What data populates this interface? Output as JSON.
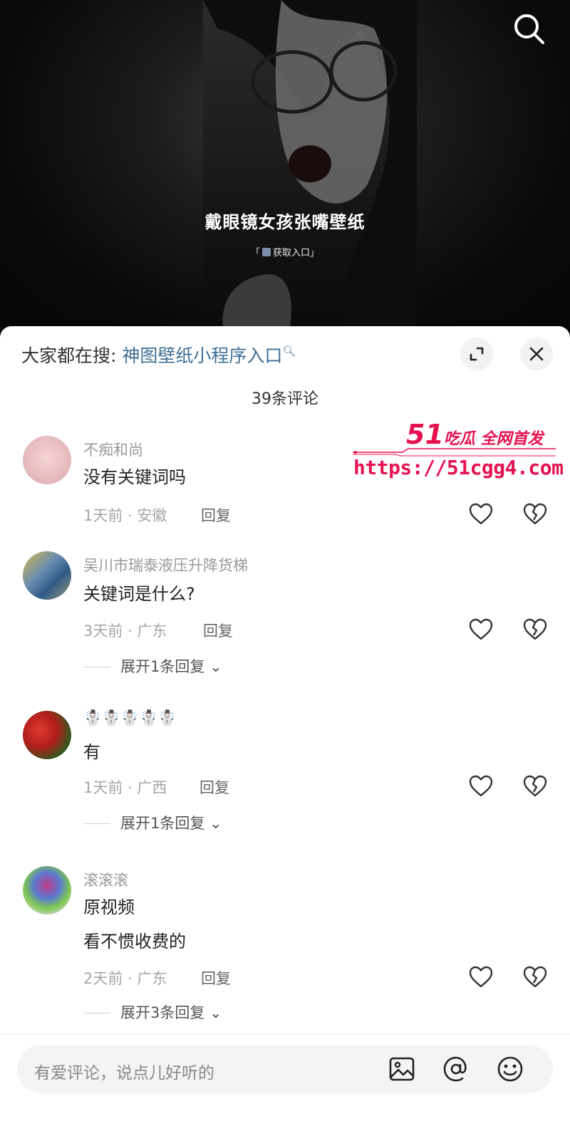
{
  "video": {
    "title": "戴眼镜女孩张嘴壁纸",
    "subtitle_left": "「",
    "subtitle_text": "获取入口」"
  },
  "sheet": {
    "search_prefix": "大家都在搜:",
    "search_keyword": "神图壁纸小程序入口",
    "comment_count": "39条评论"
  },
  "comments": [
    {
      "name": "不痴和尚",
      "text": "没有关键词吗",
      "meta": "1天前 · 安徽",
      "reply": "回复"
    },
    {
      "name": "吴川市瑞泰液压升降货梯",
      "text": "关键词是什么?",
      "meta": "3天前 · 广东",
      "reply": "回复",
      "expand": "展开1条回复"
    },
    {
      "name": "☃️☃️☃️☃️☃️",
      "text": "有",
      "meta": "1天前 · 广西",
      "reply": "回复",
      "expand": "展开1条回复"
    },
    {
      "name": "滚滚滚",
      "text_line1": "原视频",
      "text_line2": "看不惯收费的",
      "meta": "2天前 · 广东",
      "reply": "回复",
      "expand": "展开3条回复"
    }
  ],
  "watermark": {
    "brand_num": "51",
    "brand_text": "吃瓜 全网首发",
    "url": "https://51cgg4.com"
  },
  "input": {
    "placeholder": "有爱评论，说点儿好听的"
  },
  "colors": {
    "keyword": "#3f6f95",
    "watermark": "#e6114f"
  }
}
